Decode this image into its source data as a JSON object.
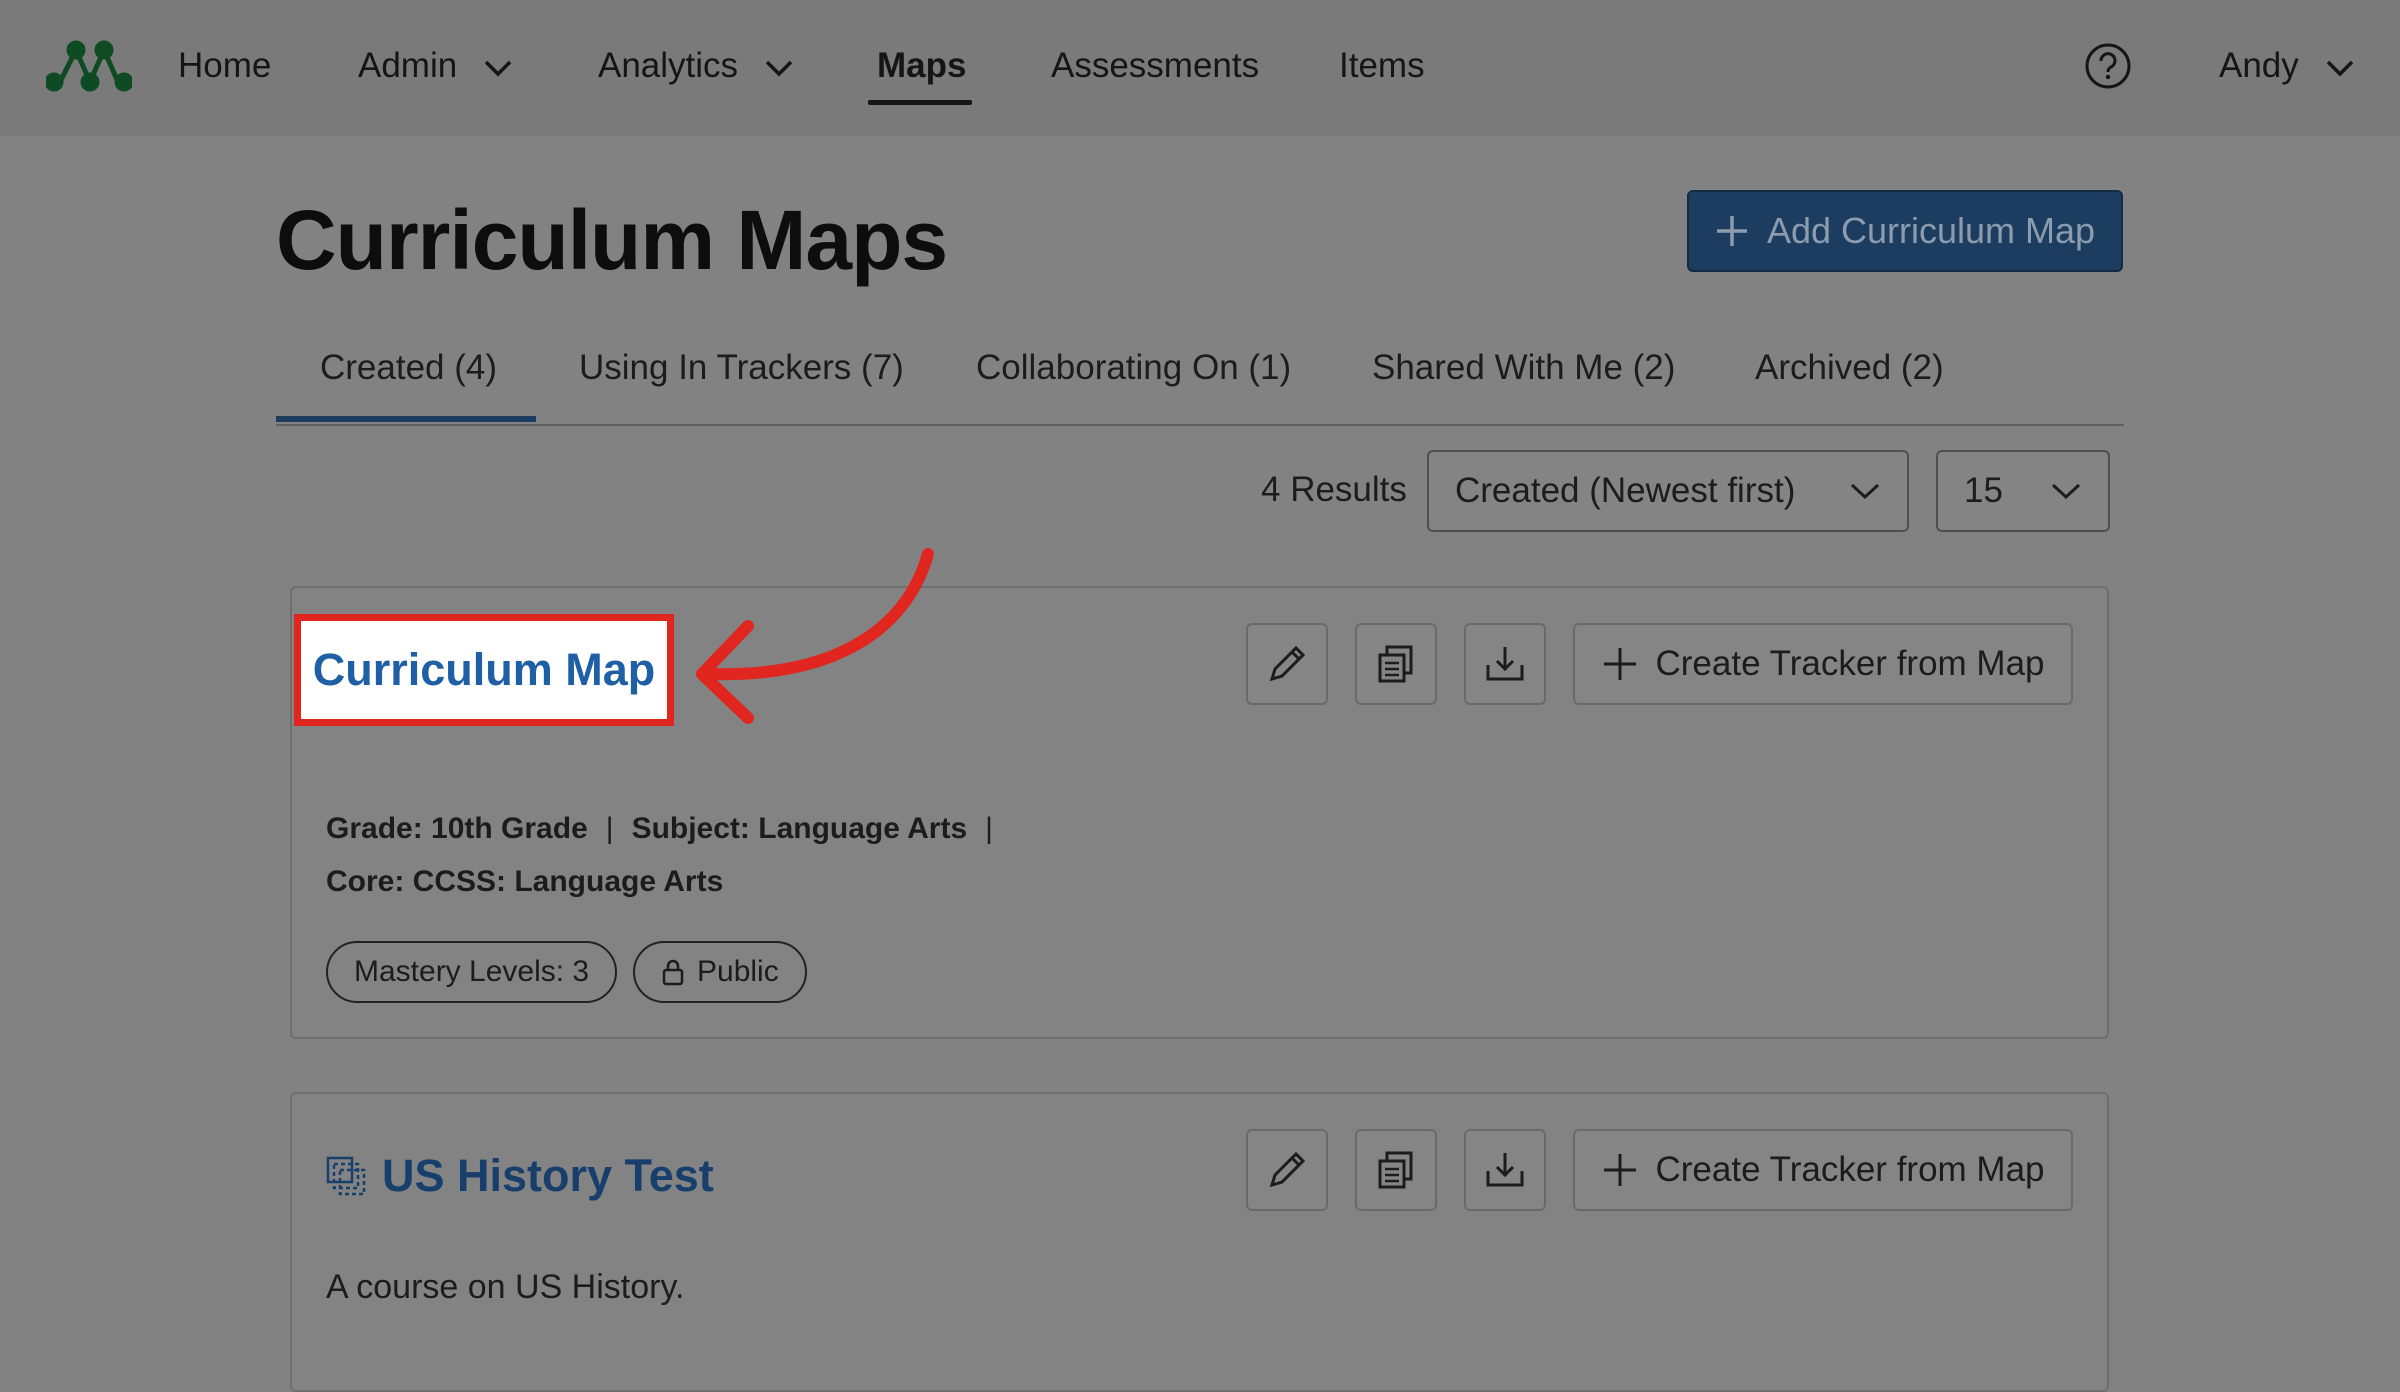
{
  "nav": {
    "items": [
      {
        "label": "Home"
      },
      {
        "label": "Admin"
      },
      {
        "label": "Analytics"
      },
      {
        "label": "Maps"
      },
      {
        "label": "Assessments"
      },
      {
        "label": "Items"
      }
    ],
    "user": "Andy"
  },
  "page": {
    "title": "Curriculum Maps",
    "add_button": "Add Curriculum Map"
  },
  "tabs": [
    {
      "label": "Created (4)"
    },
    {
      "label": "Using In Trackers (7)"
    },
    {
      "label": "Collaborating On (1)"
    },
    {
      "label": "Shared With Me (2)"
    },
    {
      "label": "Archived (2)"
    }
  ],
  "results": {
    "count": "4 Results",
    "sort": "Created (Newest first)",
    "per_page": "15"
  },
  "maps": [
    {
      "title": "Curriculum Map",
      "grade": "Grade: 10th Grade",
      "subject": "Subject: Language Arts",
      "core": "Core: CCSS: Language Arts",
      "mastery": "Mastery Levels: 3",
      "visibility": "Public",
      "tracker_button": "Create Tracker from Map"
    },
    {
      "title": "US History Test",
      "description": "A course on US History.",
      "tracker_button": "Create Tracker from Map"
    }
  ],
  "separator": "|",
  "colors": {
    "overlay_bg": "#828282",
    "primary_button": "#1c3d60",
    "link_blue": "#1f5fa6",
    "highlight_red": "#e0261f",
    "logo_green": "#0e4a22"
  },
  "icons": [
    "logo-icon",
    "chevron-down-icon",
    "help-icon",
    "plus-icon",
    "pencil-icon",
    "copy-icon",
    "download-icon",
    "lock-icon",
    "shared-map-icon",
    "arrow-annotation"
  ]
}
